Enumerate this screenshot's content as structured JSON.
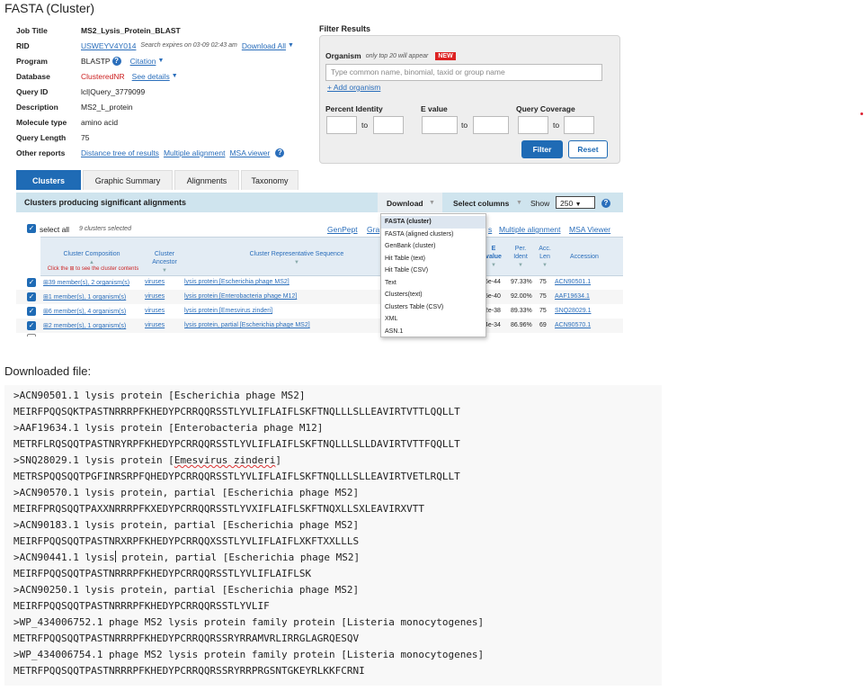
{
  "doc_title": "FASTA (Cluster)",
  "job": {
    "job_title_label": "Job Title",
    "job_title": "MS2_Lysis_Protein_BLAST",
    "rid_label": "RID",
    "rid": "USWEYV4Y014",
    "rid_note": "Search expires on 03-09 02:43 am",
    "download_all": "Download All",
    "program_label": "Program",
    "program": "BLASTP",
    "citation": "Citation",
    "database_label": "Database",
    "database": "ClusteredNR",
    "see_details": "See details",
    "query_id_label": "Query ID",
    "query_id": "lcl|Query_3779099",
    "description_label": "Description",
    "description": "MS2_L_protein",
    "molecule_label": "Molecule type",
    "molecule": "amino acid",
    "query_length_label": "Query Length",
    "query_length": "75",
    "other_reports_label": "Other reports",
    "distance_tree": "Distance tree of results",
    "multiple_alignment": "Multiple alignment",
    "msa_viewer": "MSA viewer"
  },
  "filter": {
    "title": "Filter Results",
    "organism_label": "Organism",
    "organism_note": "only top 20 will appear",
    "new_badge": "NEW",
    "organism_placeholder": "Type common  name, binomial, taxid or group  name",
    "add_organism": "+ Add organism",
    "percent_identity": "Percent Identity",
    "e_value": "E value",
    "query_coverage": "Query Coverage",
    "to": "to",
    "filter_btn": "Filter",
    "reset_btn": "Reset"
  },
  "tabs": [
    "Clusters",
    "Graphic Summary",
    "Alignments",
    "Taxonomy"
  ],
  "results": {
    "title": "Clusters producing significant alignments",
    "download": "Download",
    "select_columns": "Select columns",
    "show": "Show",
    "show_value": "250",
    "select_all": "select all",
    "selected_note": "9 clusters selected",
    "genpept": "GenPept",
    "gra": "Gra",
    "s_frag": "s",
    "multiple_alignment": "Multiple alignment",
    "msa_viewer": "MSA Viewer"
  },
  "columns": {
    "composition": "Cluster Composition",
    "click_hint": "Click the ⊞ to see the cluster contents",
    "ancestor": "Cluster Ancestor",
    "rep_seq": "Cluster Representative Sequence",
    "e": "E",
    "value": "value",
    "per": "Per.",
    "ident": "Ident",
    "acc": "Acc.",
    "len": "Len",
    "accession": "Accession"
  },
  "rows": [
    {
      "comp": "⊞39 member(s), 2 organism(s)",
      "ancestor": "viruses",
      "seq": "lysis protein [Escherichia phage MS2]",
      "evalue": "6e-44",
      "ident": "97.33%",
      "len": "75",
      "acc": "ACN90501.1"
    },
    {
      "comp": "⊞1 member(s), 1 organism(s)",
      "ancestor": "viruses",
      "seq": "lysis protein [Enterobacteria phage M12]",
      "evalue": "5e-40",
      "ident": "92.00%",
      "len": "75",
      "acc": "AAF19634.1"
    },
    {
      "comp": "⊞6 member(s), 4 organism(s)",
      "ancestor": "viruses",
      "seq": "lysis protein [Emesvirus zinderi]",
      "evalue": "2e-38",
      "ident": "89.33%",
      "len": "75",
      "acc": "SNQ28029.1"
    },
    {
      "comp": "⊞2 member(s), 1 organism(s)",
      "ancestor": "viruses",
      "seq": "lysis protein, partial [Escherichia phage MS2]",
      "evalue": "4e-34",
      "ident": "86.96%",
      "len": "69",
      "acc": "ACN90570.1"
    }
  ],
  "download_menu": [
    "FASTA (cluster)",
    "FASTA (aligned clusters)",
    "GenBank (cluster)",
    "Hit Table (text)",
    "Hit Table (CSV)",
    "Text",
    "Clusters(text)",
    "Clusters Table (CSV)",
    "XML",
    "ASN.1"
  ],
  "downloaded_label": "Downloaded file:",
  "file_lines": [
    ">ACN90501.1 lysis protein [Escherichia phage MS2]",
    "MEIRFPQQSQKTPASTNRRRPFKHEDYPCRRQQRSSTLYVLIFLAIFLSKFTNQLLLSLLEAVIRTVTTLQQLLT",
    ">AAF19634.1 lysis protein [Enterobacteria phage M12]",
    "METRFLRQSQQTPASTNRYRPFKHEDYPCRRQQRSSTLYVLIFLAIFLSKFTNQLLLSLLDAVIRTVTTFQQLLT",
    ">SNQ28029.1 lysis protein [",
    "METRSPQQSQQTPGFINRSRPFQHEDYPCRRQQRSSTLYVLIFLAIFLSKFTNQLLLSLLEAVIRTVETLRQLLT",
    ">ACN90570.1 lysis protein, partial [Escherichia phage MS2]",
    "MEIRFPRQSQQTPAXXNRRRPFKXEDYPCRRQQRSSTLYVXIFLAIFLSKFTNQXLLSXLEAVIRXVTT",
    ">ACN90183.1 lysis protein, partial [Escherichia phage MS2]",
    "MEIRFPQQSQQTPASTNRXRPFKHEDYPCRRQQXSSTLYVLIFLAIFLXKFTXXLLLS",
    ">ACN90441.1 lysis",
    "MEIRFPQQSQQTPASTNRRRPFKHEDYPCRRQQRSSTLYVLIFLAIFLSK",
    ">ACN90250.1 lysis protein, partial [Escherichia phage MS2]",
    "MEIRFPQQSQQTPASTNRRRPFKHEDYPCRRQQRSSTLYVLIF",
    ">WP_434006752.1 phage MS2 lysis protein family protein [Listeria monocytogenes]",
    "METRFPQQSQQTPASTNRRRPFKHEDYPCRRQQRSSRYRRAMVRLIRRGLAGRQESQV",
    ">WP_434006754.1 phage MS2 lysis protein family protein [Listeria monocytogenes]",
    "METRFPQQSQQTPASTNRRRPFKHEDYPCRRQQRSSRYRRPRGSNTGKEYRLKKFCRNI"
  ],
  "squiggle_text": "Emesvirus zinderi",
  "squiggle_tail": "]",
  "cursor_tail": " protein, partial [Escherichia phage MS2]",
  "colors": {
    "primary": "#1f6bb5",
    "link": "#2a6ebb",
    "header_bg": "#cfe4ee",
    "new_badge": "#dd2222"
  }
}
